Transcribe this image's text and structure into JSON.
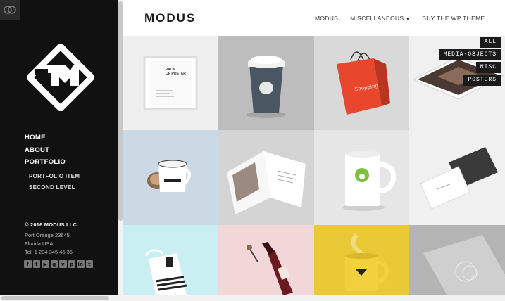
{
  "sidebar": {
    "nav": [
      "HOME",
      "ABOUT",
      "PORTFOLIO"
    ],
    "subnav": [
      "PORTFOLIO ITEM",
      "SECOND LEVEL"
    ],
    "copyright": "© 2016 MODUS LLC.",
    "address": [
      "Port Orange 23645,",
      "Florida USA",
      "Tel: 1 234 345 45 35"
    ],
    "social_icons": [
      "facebook-icon",
      "twitter-icon",
      "youtube-icon",
      "google-plus-icon",
      "vimeo-icon",
      "pinterest-icon",
      "linkedin-icon",
      "tumblr-icon"
    ],
    "social_glyphs": [
      "f",
      "t",
      "▶",
      "g",
      "v",
      "p",
      "in",
      "t"
    ]
  },
  "header": {
    "title": "MODUS",
    "nav": {
      "modus": "MODUS",
      "misc": "MISCELLANEOUS",
      "buy": "BUY THE WP THEME"
    }
  },
  "filters": [
    "ALL",
    "MEDIA-OBJECTS",
    "MISC",
    "POSTERS"
  ],
  "grid": {
    "tiles": [
      {
        "name": "poster-frame",
        "bg": "#efefef"
      },
      {
        "name": "coffee-cup",
        "bg": "#bdbdbd"
      },
      {
        "name": "shopping-bag",
        "bg": "#d9d9d9"
      },
      {
        "name": "tablet",
        "bg": "#f0f0f0"
      },
      {
        "name": "enamel-mug",
        "bg": "#cbd9e4"
      },
      {
        "name": "magazine",
        "bg": "#d4d4d4"
      },
      {
        "name": "white-mug",
        "bg": "#e6e6e6"
      },
      {
        "name": "business-cards",
        "bg": "#f0f0f0"
      },
      {
        "name": "tote-bag",
        "bg": "#c9eff3"
      },
      {
        "name": "wine-bottle",
        "bg": "#f3d6d8"
      },
      {
        "name": "yellow-mug",
        "bg": "#e9c935"
      },
      {
        "name": "notebook",
        "bg": "#b4b4b4"
      }
    ],
    "poster_text": [
      "PACK",
      "OF POSTER"
    ],
    "colors": {
      "bag": "#e8472d",
      "cup_dark": "#4a5662",
      "mug_green": "#7dbf3e",
      "wine": "#6b1a1f"
    }
  }
}
